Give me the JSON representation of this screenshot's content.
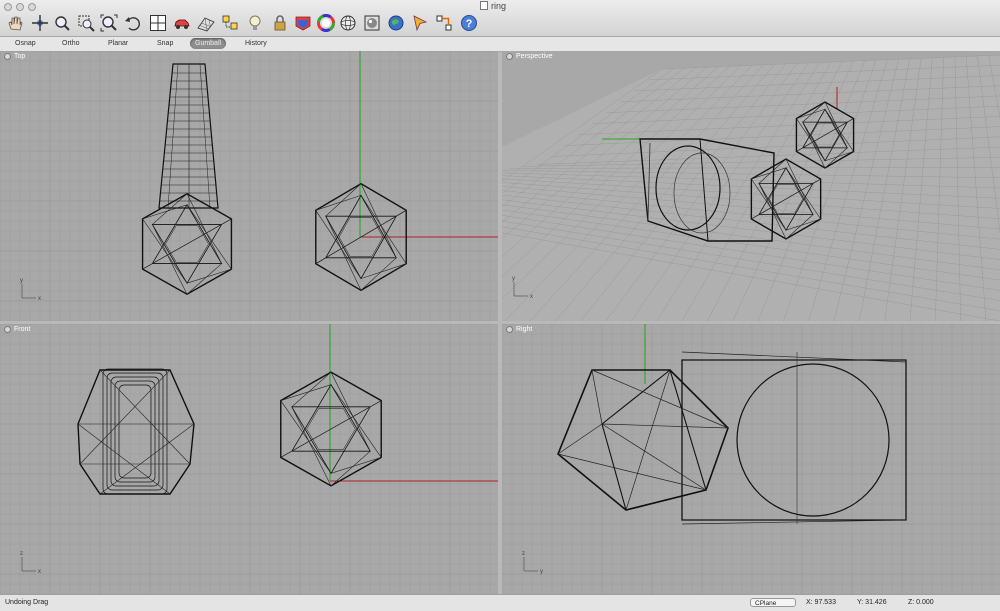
{
  "window": {
    "title": "ring"
  },
  "toolbar": {
    "icons": [
      "hand-pan-icon",
      "rotate-view-icon",
      "zoom-icon",
      "zoom-window-icon",
      "zoom-extents-icon",
      "undo-view-icon",
      "four-viewports-icon",
      "car-model-icon",
      "surface-mesh-icon",
      "select-objects-icon",
      "light-bulb-icon",
      "lock-icon",
      "layer-color-icon",
      "color-wheel-icon",
      "sphere-icon",
      "render-icon",
      "globe-icon",
      "cursor-icon",
      "snap-points-icon",
      "help-icon"
    ]
  },
  "modes": [
    {
      "label": "Osnap",
      "active": false
    },
    {
      "label": "Ortho",
      "active": false
    },
    {
      "label": "Planar",
      "active": false
    },
    {
      "label": "Snap",
      "active": false
    },
    {
      "label": "Gumball",
      "active": true
    },
    {
      "label": "History",
      "active": false
    }
  ],
  "viewports": {
    "top": {
      "label": "Top",
      "axis_y": "y",
      "axis_x": "x"
    },
    "perspective": {
      "label": "Perspective",
      "axis_y": "y",
      "axis_x": "x"
    },
    "front": {
      "label": "Front",
      "axis_y": "z",
      "axis_x": "x"
    },
    "right": {
      "label": "Right",
      "axis_y": "z",
      "axis_x": "y"
    }
  },
  "status": {
    "message": "Undoing Drag",
    "cplane": "CPlane",
    "x": "X: 97.533",
    "y": "Y: 31.426",
    "z": "Z: 0.000"
  },
  "colors": {
    "viewport": "#a8a8a8",
    "grid": "#9a9a9a",
    "x_axis": "#b02020",
    "y_axis": "#20a020",
    "wire": "#111111"
  }
}
